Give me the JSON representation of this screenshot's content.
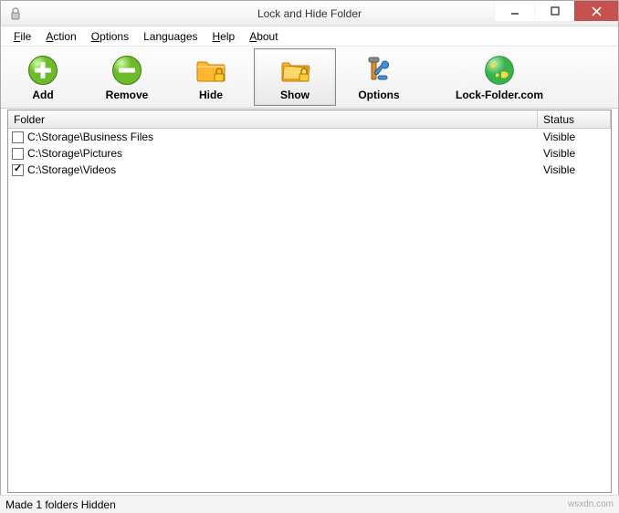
{
  "window": {
    "title": "Lock and Hide Folder"
  },
  "menu": {
    "file": "File",
    "action": "Action",
    "options": "Options",
    "languages": "Languages",
    "help": "Help",
    "about": "About"
  },
  "toolbar": {
    "add": "Add",
    "remove": "Remove",
    "hide": "Hide",
    "show": "Show",
    "options": "Options",
    "website": "Lock-Folder.com"
  },
  "columns": {
    "folder": "Folder",
    "status": "Status"
  },
  "rows": [
    {
      "checked": false,
      "path": "C:\\Storage\\Business Files",
      "status": "Visible"
    },
    {
      "checked": false,
      "path": "C:\\Storage\\Pictures",
      "status": "Visible"
    },
    {
      "checked": true,
      "path": "C:\\Storage\\Videos",
      "status": "Visible"
    }
  ],
  "status": "Made  1  folders Hidden",
  "watermark": "wsxdn.com"
}
